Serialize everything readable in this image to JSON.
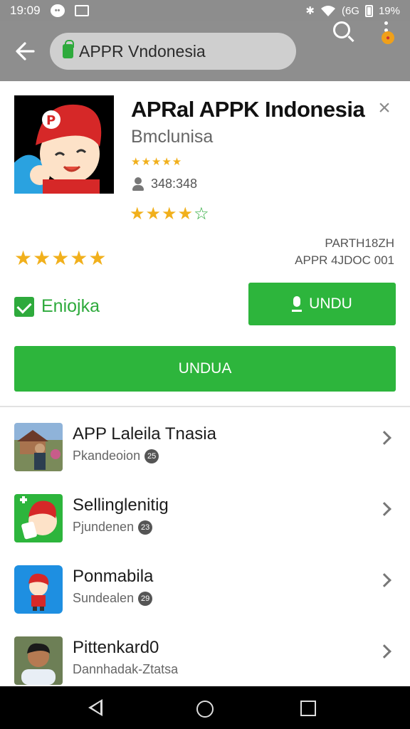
{
  "status_bar": {
    "time": "19:09",
    "network": "(6G",
    "battery": "19%"
  },
  "toolbar": {
    "url": "APPR Vndonesia"
  },
  "app": {
    "title": "APRal APPK Indonesia",
    "developer": "Bmclunisa",
    "small_rating_stars": "★★★★★",
    "downloads": "348:348",
    "rating_stars": "★★★★",
    "rating_empty_star": "☆",
    "big_stars": "★★★★★",
    "meta_line1": "PARTH18ZH",
    "meta_line2": "APPR 4JDOC 001",
    "checkbox_label": "Eniojka",
    "install_button": "UNDU",
    "download_button": "UNDUA"
  },
  "list": [
    {
      "title": "APP Laleila Tnasia",
      "subtitle": "Pkandeoion",
      "badge": "25"
    },
    {
      "title": "Sellinglenitig",
      "subtitle": "Pjundenen",
      "badge": "23"
    },
    {
      "title": "Ponmabila",
      "subtitle": "Sundealen",
      "badge": "29"
    },
    {
      "title": "Pittenkard0",
      "subtitle": "Dannhadak-Ztatsa",
      "badge": ""
    }
  ],
  "colors": {
    "accent": "#2db53c",
    "star": "#f1b01c",
    "toolbar": "#8e8e8e"
  }
}
